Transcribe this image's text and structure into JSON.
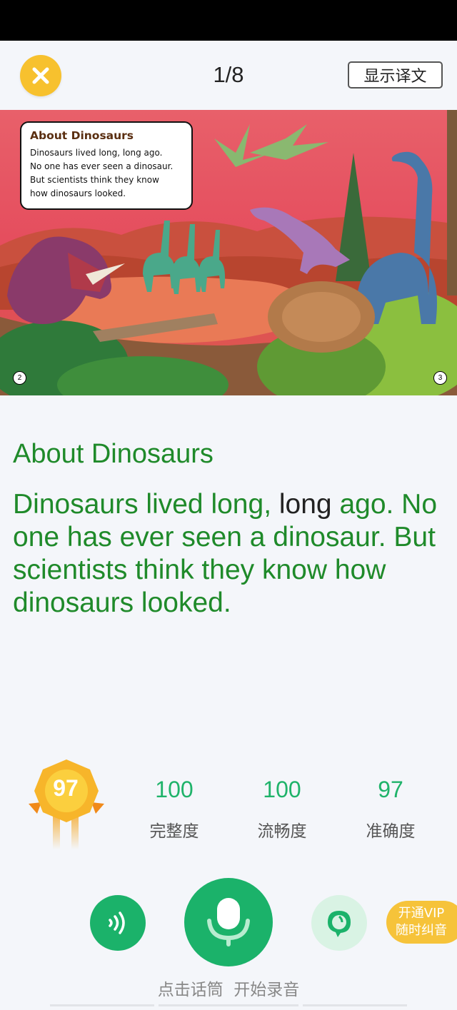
{
  "header": {
    "page_counter": "1/8",
    "translate_button": "显示译文"
  },
  "illustration": {
    "caption_title": "About Dinosaurs",
    "caption_lines": [
      "Dinosaurs lived long, long ago.",
      "No one has ever seen a dinosaur.",
      "But scientists think they know",
      "how dinosaurs looked."
    ],
    "left_page_number": "2",
    "right_page_number": "3"
  },
  "story": {
    "title": "About Dinosaurs",
    "text_before": "Dinosaurs lived long, ",
    "text_highlight": "long",
    "text_after": " ago. No one has ever seen a dinosaur. But scientists think they know how dinosaurs looked."
  },
  "scores": {
    "overall": "97",
    "metrics": [
      {
        "value": "100",
        "label": "完整度"
      },
      {
        "value": "100",
        "label": "流畅度"
      },
      {
        "value": "97",
        "label": "准确度"
      }
    ]
  },
  "controls": {
    "play_icon": "sound-wave-icon",
    "mic_icon": "microphone-icon",
    "reply_icon": "speech-bubble-icon",
    "vip_line1": "开通VIP",
    "vip_line2": "随时纠音",
    "mic_hint": "点击话筒  开始录音"
  },
  "colors": {
    "accent_green": "#1bb26a",
    "text_green": "#1f8a2a",
    "close_yellow": "#f7c12e",
    "vip_yellow": "#f6c33a"
  }
}
